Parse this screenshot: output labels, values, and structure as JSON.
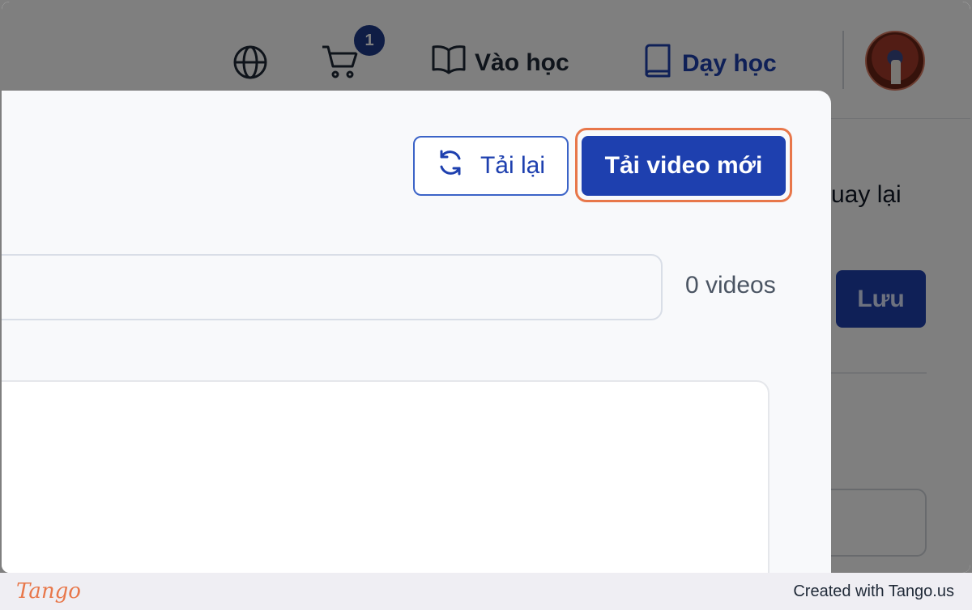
{
  "header": {
    "cart_badge": "1",
    "learn_label": "Vào học",
    "teach_label": "Dạy học"
  },
  "background": {
    "back_label": "uay lại",
    "save_label": "Lưu"
  },
  "modal": {
    "reload_label": "Tải lại",
    "upload_label": "Tải video mới",
    "search_placeholder": "",
    "video_count": "0 videos"
  },
  "footer": {
    "logo_text": "Tango",
    "credit": "Created with Tango.us"
  },
  "colors": {
    "primary": "#1e40af",
    "highlight": "#e8774a",
    "overlay": "rgba(0,0,0,0.5)"
  }
}
